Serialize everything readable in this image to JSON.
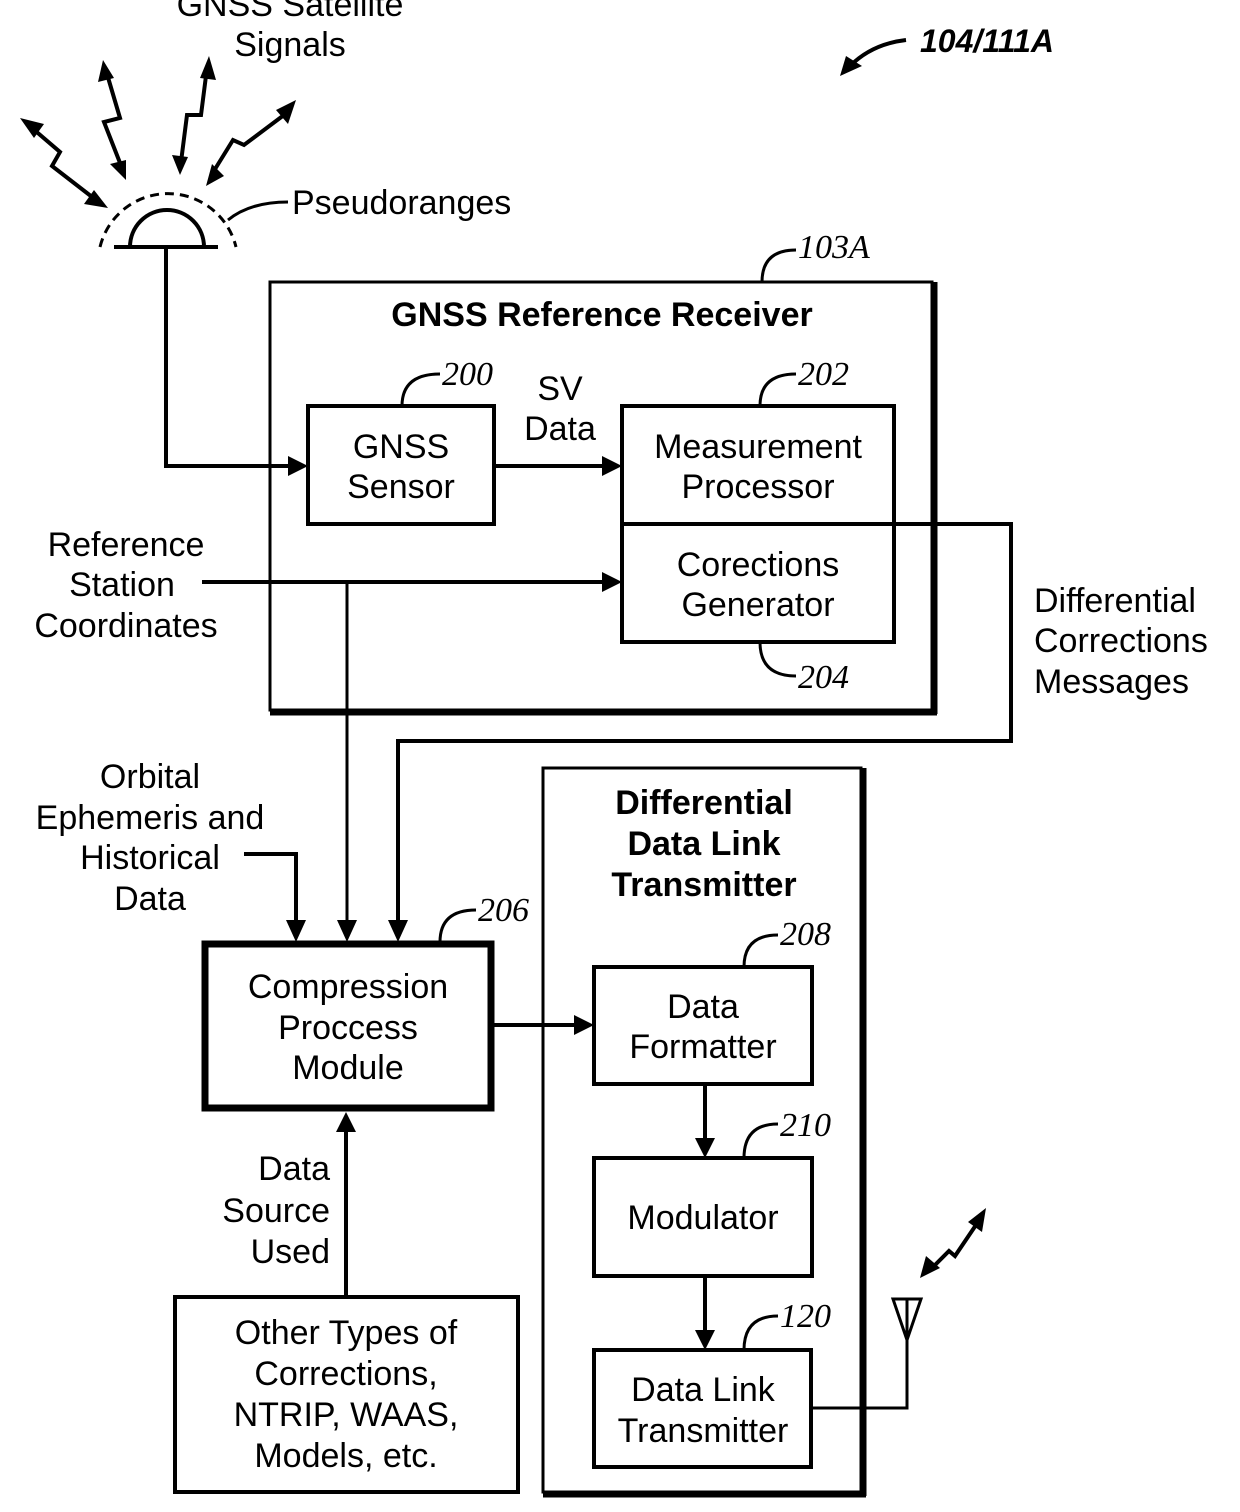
{
  "figure_ref": "104/111A",
  "satellite": {
    "title_lines": [
      "GNSS Satellite",
      "Signals"
    ],
    "pseudoranges_label": "Pseudoranges"
  },
  "reference_receiver": {
    "ref": "103A",
    "title": "GNSS Reference Receiver",
    "gnss_sensor": {
      "ref": "200",
      "lines": [
        "GNSS",
        "Sensor"
      ]
    },
    "sv_data_lines": [
      "SV",
      "Data"
    ],
    "measurement_processor": {
      "ref": "202",
      "lines": [
        "Measurement",
        "Processor"
      ]
    },
    "corrections_generator": {
      "ref": "204",
      "lines": [
        "Corections",
        "Generator"
      ]
    }
  },
  "reference_station_lines": [
    "Reference",
    "Station",
    "Coordinates"
  ],
  "differential_corrections_lines": [
    "Differential",
    "Corrections",
    "Messages"
  ],
  "orbital_lines": [
    "Orbital",
    "Ephemeris and",
    "Historical",
    "Data"
  ],
  "compression_module": {
    "ref": "206",
    "lines": [
      "Compression",
      "Proccess",
      "Module"
    ]
  },
  "data_source_lines": [
    "Data",
    "Source",
    "Used"
  ],
  "other_types": {
    "lines": [
      "Other Types of",
      "Corrections,",
      "NTRIP, WAAS,",
      "Models, etc."
    ]
  },
  "transmitter": {
    "title_lines": [
      "Differential",
      "Data Link",
      "Transmitter"
    ],
    "data_formatter": {
      "ref": "208",
      "lines": [
        "Data",
        "Formatter"
      ]
    },
    "modulator": {
      "ref": "210",
      "lines": [
        "Modulator"
      ]
    },
    "data_link_transmitter": {
      "ref": "120",
      "lines": [
        "Data Link",
        "Transmitter"
      ]
    }
  }
}
